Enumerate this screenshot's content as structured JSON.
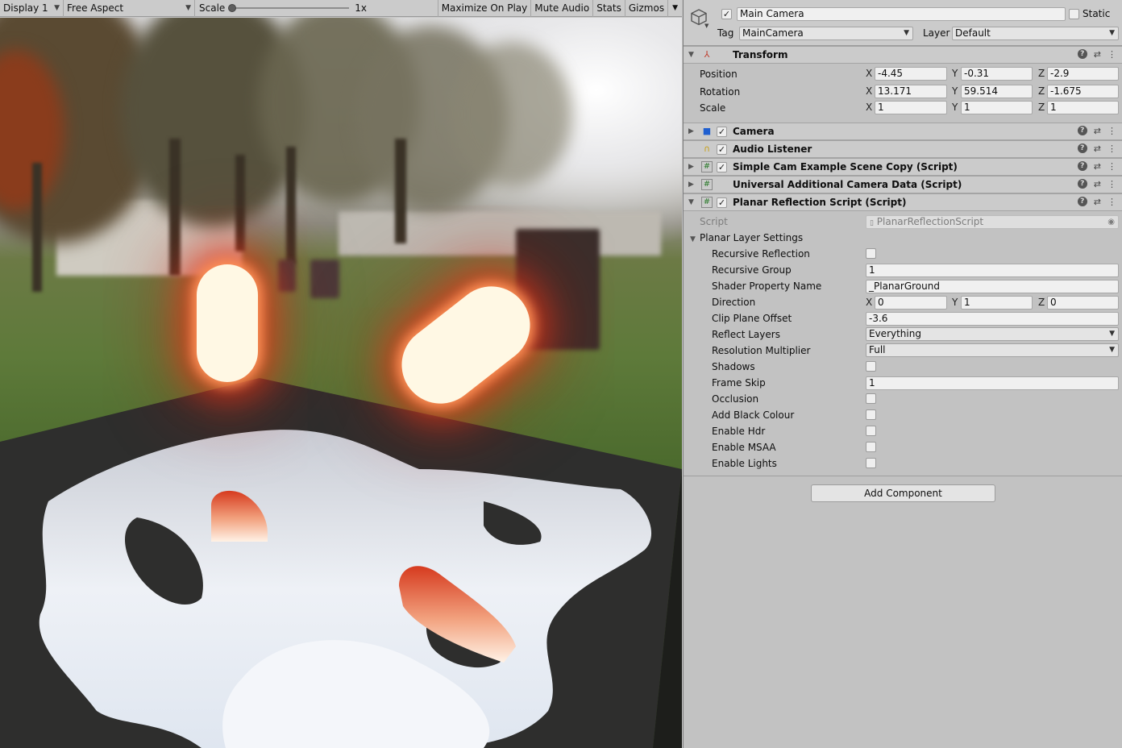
{
  "game_toolbar": {
    "display": "Display 1",
    "aspect": "Free Aspect",
    "scale_label": "Scale",
    "scale_value": "1x",
    "scale_slider_fraction": 0.0,
    "maximize": "Maximize On Play",
    "mute": "Mute Audio",
    "stats": "Stats",
    "gizmos": "Gizmos"
  },
  "inspector": {
    "object_name": "Main Camera",
    "active": true,
    "static_label": "Static",
    "static": false,
    "tag_label": "Tag",
    "tag_value": "MainCamera",
    "layer_label": "Layer",
    "layer_value": "Default",
    "transform": {
      "title": "Transform",
      "position_label": "Position",
      "rotation_label": "Rotation",
      "scale_label": "Scale",
      "axis": [
        "X",
        "Y",
        "Z"
      ],
      "position": [
        "-4.45",
        "-0.31",
        "-2.9"
      ],
      "rotation": [
        "13.171",
        "59.514",
        "-1.675"
      ],
      "scale": [
        "1",
        "1",
        "1"
      ]
    },
    "components": [
      {
        "title": "Camera",
        "icon": "camera-icon",
        "enabled": true
      },
      {
        "title": "Audio Listener",
        "icon": "headphones-icon",
        "enabled": true
      },
      {
        "title": "Simple Cam Example Scene Copy (Script)",
        "icon": "script-icon",
        "enabled": true
      },
      {
        "title": "Universal Additional Camera Data (Script)",
        "icon": "script-icon",
        "enabled": false
      },
      {
        "title": "Planar Reflection Script (Script)",
        "icon": "script-icon",
        "enabled": true
      }
    ],
    "planar": {
      "script_label": "Script",
      "script_value": "PlanarReflectionScript",
      "group_label": "Planar Layer Settings",
      "recursive_reflection": "Recursive Reflection",
      "recursive_group": "Recursive Group",
      "recursive_group_value": "1",
      "shader_property_name": "Shader Property Name",
      "shader_property_value": "_PlanarGround",
      "direction": "Direction",
      "direction_values": [
        "0",
        "1",
        "0"
      ],
      "clip_plane_offset": "Clip Plane Offset",
      "clip_plane_offset_value": "-3.6",
      "reflect_layers": "Reflect Layers",
      "reflect_layers_value": "Everything",
      "resolution_multiplier": "Resolution Multiplier",
      "resolution_multiplier_value": "Full",
      "shadows": "Shadows",
      "frame_skip": "Frame Skip",
      "frame_skip_value": "1",
      "occlusion": "Occlusion",
      "add_black_colour": "Add Black Colour",
      "enable_hdr": "Enable Hdr",
      "enable_msaa": "Enable MSAA",
      "enable_lights": "Enable Lights"
    },
    "add_component": "Add Component"
  }
}
